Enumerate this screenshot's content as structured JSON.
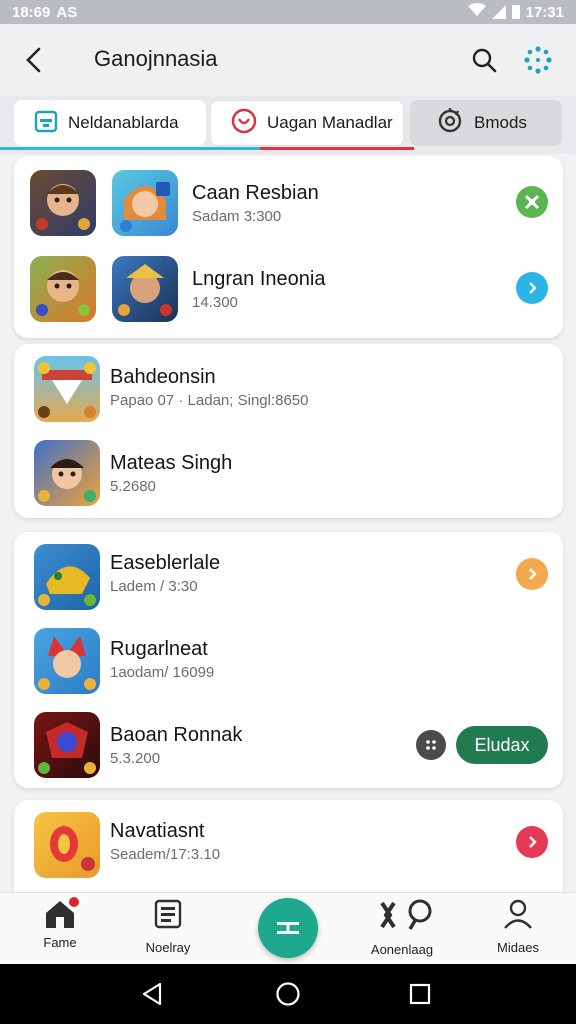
{
  "status_bar": {
    "time_left": "18:69",
    "left_label": "AS",
    "time_right": "17:31"
  },
  "app_bar": {
    "title": "Ganojnnasia",
    "back_icon": "back-arrow-icon",
    "search_icon": "search-icon",
    "menu_icon": "dots-grid-icon"
  },
  "tabs": [
    {
      "label": "Neldanablarda",
      "icon": "calendar-icon",
      "selected": true
    },
    {
      "label": "Uagan Manadlar",
      "icon": "target-icon",
      "selected": false
    },
    {
      "label": "Bmods",
      "icon": "gear-icon",
      "selected": false
    }
  ],
  "cards": [
    {
      "rows": [
        {
          "name": "Caan Resbian",
          "sub": "Sadam  3:300",
          "action_icon": "grid-badge-icon",
          "action_color": "#5bb551"
        },
        {
          "name": "Lngran Ineonia",
          "sub": "14.300",
          "action_icon": "chevron-right-icon",
          "action_color": "#2bb4e5"
        }
      ]
    },
    {
      "rows": [
        {
          "name": "Bahdeonsin",
          "sub": "Papao 07 · Ladan; Singl:8650"
        },
        {
          "name": "Mateas Singh",
          "sub": "5.2680"
        }
      ]
    },
    {
      "rows": [
        {
          "name": "Easeblerlale",
          "sub": "Ladem / 3:30",
          "action_icon": "chevron-right-icon",
          "action_color": "#f3a950"
        },
        {
          "name": "Rugarlneat",
          "sub": "1aodam/ 16099"
        },
        {
          "name": "Baoan Ronnak",
          "sub": "5.3.200",
          "button_label": "Eludax",
          "extra_icon": "dots-icon"
        }
      ]
    },
    {
      "rows": [
        {
          "name": "Navatiasnt",
          "sub": "Seadem/17:3.10",
          "action_icon": "chevron-right-icon",
          "action_color": "#e53a56"
        }
      ]
    }
  ],
  "bottom_nav": [
    {
      "label": "Fame",
      "icon": "home-icon",
      "badge": true
    },
    {
      "label": "Noelray",
      "icon": "list-icon"
    },
    {
      "label": "",
      "icon": "plus-icon"
    },
    {
      "label": "Aonenlaag",
      "icon": "tools-icon"
    },
    {
      "label": "Midaes",
      "icon": "profile-icon"
    }
  ],
  "system_nav": {
    "back_icon": "back-triangle-icon",
    "home_icon": "home-circle-icon",
    "recents_icon": "recents-square-icon"
  },
  "colors": {
    "accent_teal": "#1ea88e",
    "tab_teal": "#37b7c9",
    "tab_red": "#e2323f",
    "pill_green": "#227b50"
  }
}
